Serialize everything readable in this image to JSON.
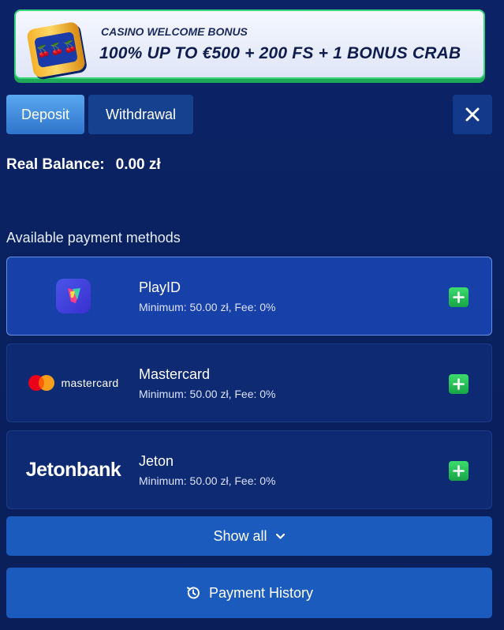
{
  "banner": {
    "subtitle": "CASINO WELCOME BONUS",
    "title": "100% UP TO €500 + 200 FS + 1 BONUS CRAB",
    "icon": "slot-machine-icon"
  },
  "tabs": [
    {
      "label": "Deposit",
      "active": true
    },
    {
      "label": "Withdrawal",
      "active": false
    }
  ],
  "close_icon": "close-icon",
  "balance": {
    "label": "Real Balance:",
    "amount": "0.00 zł"
  },
  "methods_title": "Available payment methods",
  "methods": [
    {
      "name": "PlayID",
      "info": "Minimum: 50.00 zł, Fee: 0%",
      "logo": "playid-logo",
      "selected": true
    },
    {
      "name": "Mastercard",
      "info": "Minimum: 50.00 zł, Fee: 0%",
      "logo": "mastercard-logo",
      "logo_text": "mastercard",
      "selected": false
    },
    {
      "name": "Jeton",
      "info": "Minimum: 50.00 zł, Fee: 0%",
      "logo": "jetonbank-logo",
      "logo_text": "Jetonbank",
      "selected": false
    }
  ],
  "show_all_label": "Show all",
  "history_label": "Payment History",
  "colors": {
    "background": "#0a1f5c",
    "accent_button": "#1a5bbd",
    "plus_green": "#17a447",
    "banner_border": "#37d67a"
  }
}
